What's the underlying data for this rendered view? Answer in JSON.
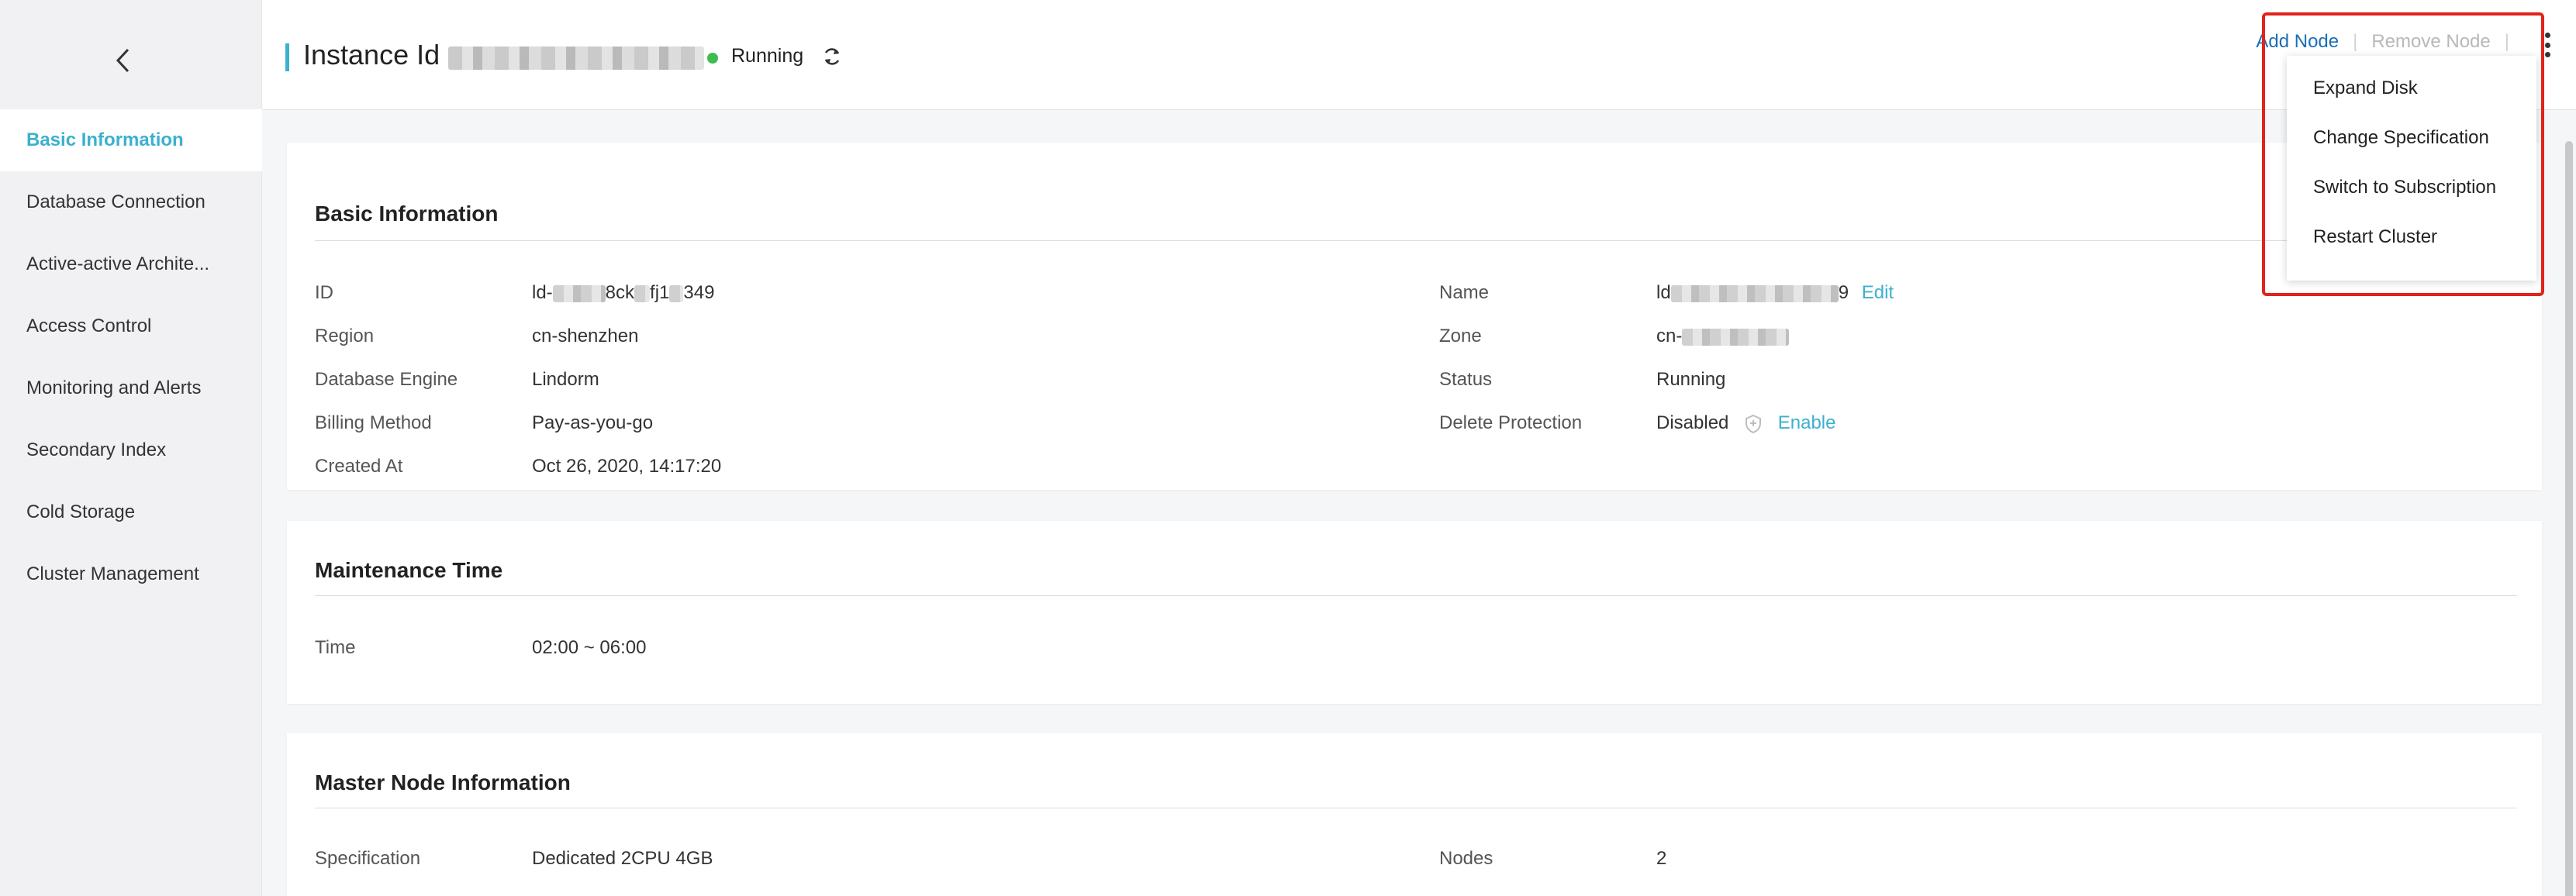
{
  "sidebar": {
    "items": [
      {
        "label": "Basic Information",
        "active": true
      },
      {
        "label": "Database Connection"
      },
      {
        "label": "Active-active Archite..."
      },
      {
        "label": "Access Control"
      },
      {
        "label": "Monitoring and Alerts"
      },
      {
        "label": "Secondary Index"
      },
      {
        "label": "Cold Storage"
      },
      {
        "label": "Cluster Management"
      }
    ]
  },
  "header": {
    "title_prefix": "Instance Id",
    "status": "Running",
    "actions": {
      "add_node": "Add Node",
      "remove_node": "Remove Node"
    }
  },
  "dropdown": {
    "items": [
      "Expand Disk",
      "Change Specification",
      "Switch to Subscription",
      "Restart Cluster"
    ]
  },
  "basic_info": {
    "title": "Basic Information",
    "left": [
      {
        "label": "ID",
        "value": "ld-"
      },
      {
        "label": "Region",
        "value": "cn-shenzhen"
      },
      {
        "label": "Database Engine",
        "value": "Lindorm"
      },
      {
        "label": "Billing Method",
        "value": "Pay-as-you-go"
      },
      {
        "label": "Created At",
        "value": "Oct 26, 2020, 14:17:20"
      }
    ],
    "id_parts": [
      "ld-",
      "8ck",
      "fj1",
      "349"
    ],
    "right": [
      {
        "label": "Name",
        "value": "ld",
        "suffix": "9",
        "link": "Edit"
      },
      {
        "label": "Zone",
        "value": "cn-"
      },
      {
        "label": "Status",
        "value": "Running"
      },
      {
        "label": "Delete Protection",
        "value": "Disabled",
        "link": "Enable"
      }
    ]
  },
  "maintenance": {
    "title": "Maintenance Time",
    "label": "Time",
    "value": "02:00 ~ 06:00"
  },
  "master": {
    "title": "Master Node Information",
    "spec_label": "Specification",
    "spec_value": "Dedicated 2CPU 4GB",
    "nodes_label": "Nodes",
    "nodes_value": "2"
  },
  "colors": {
    "accent": "#3cb0cf",
    "link_blue": "#1a6fb8",
    "running_green": "#3dbd51",
    "highlight_red": "#e2231a",
    "brand_orange": "#ff6a00"
  }
}
